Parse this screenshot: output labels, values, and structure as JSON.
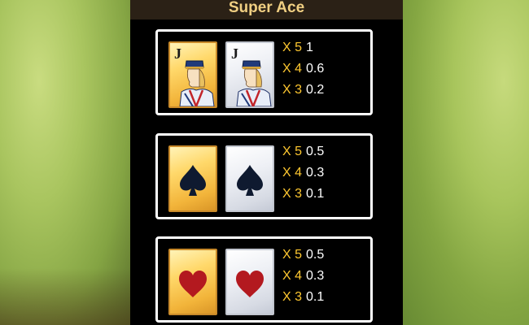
{
  "title": "Super Ace",
  "groups": [
    {
      "symbol": "jack",
      "card_letter": "J",
      "pays": [
        {
          "mult": "X 5",
          "value": "1"
        },
        {
          "mult": "X 4",
          "value": "0.6"
        },
        {
          "mult": "X 3",
          "value": "0.2"
        }
      ]
    },
    {
      "symbol": "spade",
      "pays": [
        {
          "mult": "X 5",
          "value": "0.5"
        },
        {
          "mult": "X 4",
          "value": "0.3"
        },
        {
          "mult": "X 3",
          "value": "0.1"
        }
      ]
    },
    {
      "symbol": "heart",
      "pays": [
        {
          "mult": "X 5",
          "value": "0.5"
        },
        {
          "mult": "X 4",
          "value": "0.3"
        },
        {
          "mult": "X 3",
          "value": "0.1"
        }
      ]
    }
  ],
  "colors": {
    "multiplier": "#ffc830",
    "value": "#ffffff",
    "title": "#f0cf82",
    "heart": "#b3191f",
    "spade": "#0f1a30"
  }
}
